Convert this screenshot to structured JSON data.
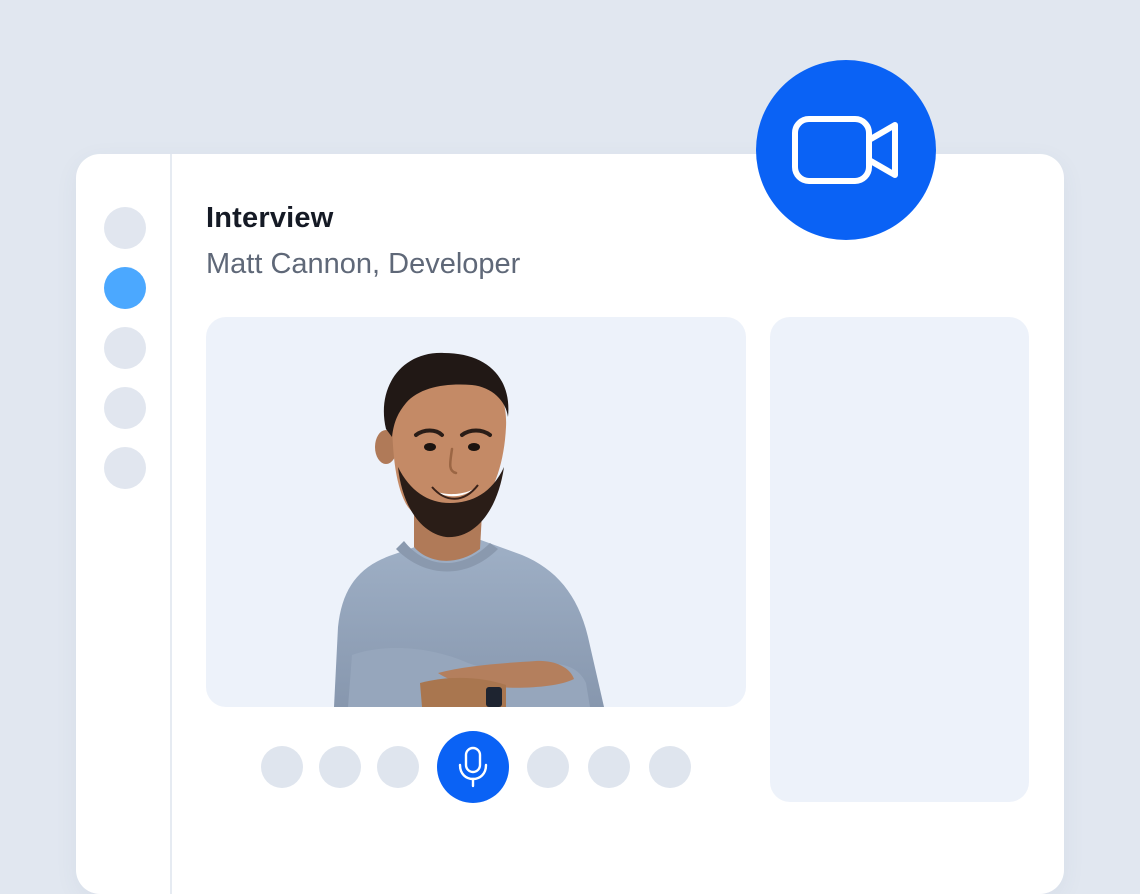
{
  "header": {
    "title": "Interview",
    "subtitle": "Matt Cannon, Developer"
  },
  "sidebar": {
    "items": [
      {
        "state": "inactive"
      },
      {
        "state": "active"
      },
      {
        "state": "inactive"
      },
      {
        "state": "inactive"
      },
      {
        "state": "inactive"
      }
    ]
  },
  "video_call": {
    "participant_photo": "smiling-man-arms-crossed",
    "controls": [
      "placeholder",
      "placeholder",
      "placeholder",
      "microphone-icon",
      "placeholder",
      "placeholder",
      "placeholder"
    ],
    "active_control": "microphone-icon"
  },
  "badge": {
    "icon": "video-camera-icon"
  },
  "colors": {
    "background": "#e1e7f0",
    "card": "#ffffff",
    "accent": "#0a62f5",
    "sidebar_active": "#4ba8ff",
    "placeholder": "#e1e6ef",
    "panel": "#edf2fa",
    "title_text": "#151a25",
    "subtitle_text": "#5f6878"
  }
}
